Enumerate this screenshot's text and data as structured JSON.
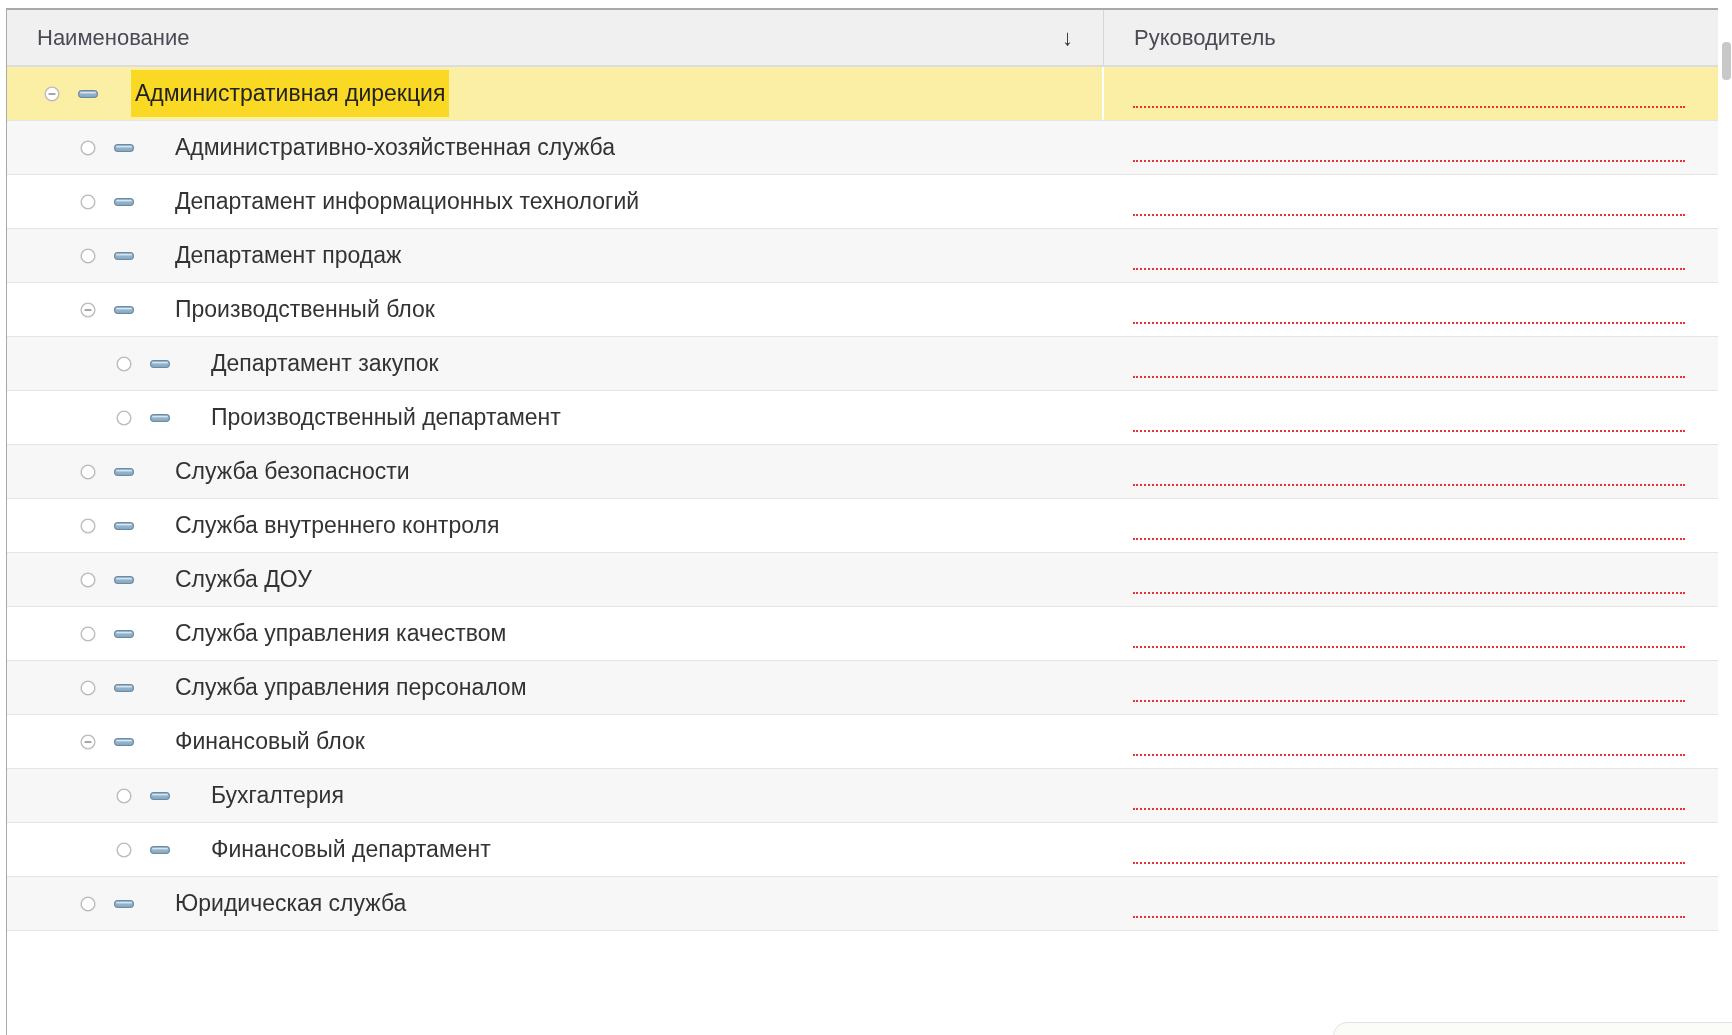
{
  "table": {
    "columns": [
      {
        "title": "Наименование",
        "sort": "↓"
      },
      {
        "title": "Руководитель"
      }
    ],
    "rows": [
      {
        "name": "Административная дирекция",
        "kind": "group",
        "expanded": true,
        "selected": true,
        "manager_required": true,
        "children": [
          {
            "name": "Административно-хозяйственная служба",
            "kind": "item",
            "selected": false,
            "manager_required": true
          },
          {
            "name": "Департамент информационных технологий",
            "kind": "item",
            "selected": false,
            "manager_required": true
          },
          {
            "name": "Департамент продаж",
            "kind": "item",
            "selected": false,
            "manager_required": true
          },
          {
            "name": "Производственный блок",
            "kind": "group",
            "expanded": true,
            "selected": false,
            "manager_required": true,
            "children": [
              {
                "name": "Департамент закупок",
                "kind": "item",
                "selected": false,
                "manager_required": true
              },
              {
                "name": "Производственный департамент",
                "kind": "item",
                "selected": false,
                "manager_required": true
              }
            ]
          },
          {
            "name": "Служба безопасности",
            "kind": "item",
            "selected": false,
            "manager_required": true
          },
          {
            "name": "Служба внутреннего контроля",
            "kind": "item",
            "selected": false,
            "manager_required": true
          },
          {
            "name": "Служба ДОУ",
            "kind": "item",
            "selected": false,
            "manager_required": true
          },
          {
            "name": "Служба управления качеством",
            "kind": "item",
            "selected": false,
            "manager_required": true
          },
          {
            "name": "Служба управления персоналом",
            "kind": "item",
            "selected": false,
            "manager_required": true
          },
          {
            "name": "Финансовый блок",
            "kind": "group",
            "expanded": true,
            "selected": false,
            "manager_required": true,
            "children": [
              {
                "name": "Бухгалтерия",
                "kind": "item",
                "selected": false,
                "manager_required": true
              },
              {
                "name": "Финансовый департамент",
                "kind": "item",
                "selected": false,
                "manager_required": true
              }
            ]
          },
          {
            "name": "Юридическая служба",
            "kind": "item",
            "selected": false,
            "manager_required": true
          }
        ]
      }
    ]
  }
}
